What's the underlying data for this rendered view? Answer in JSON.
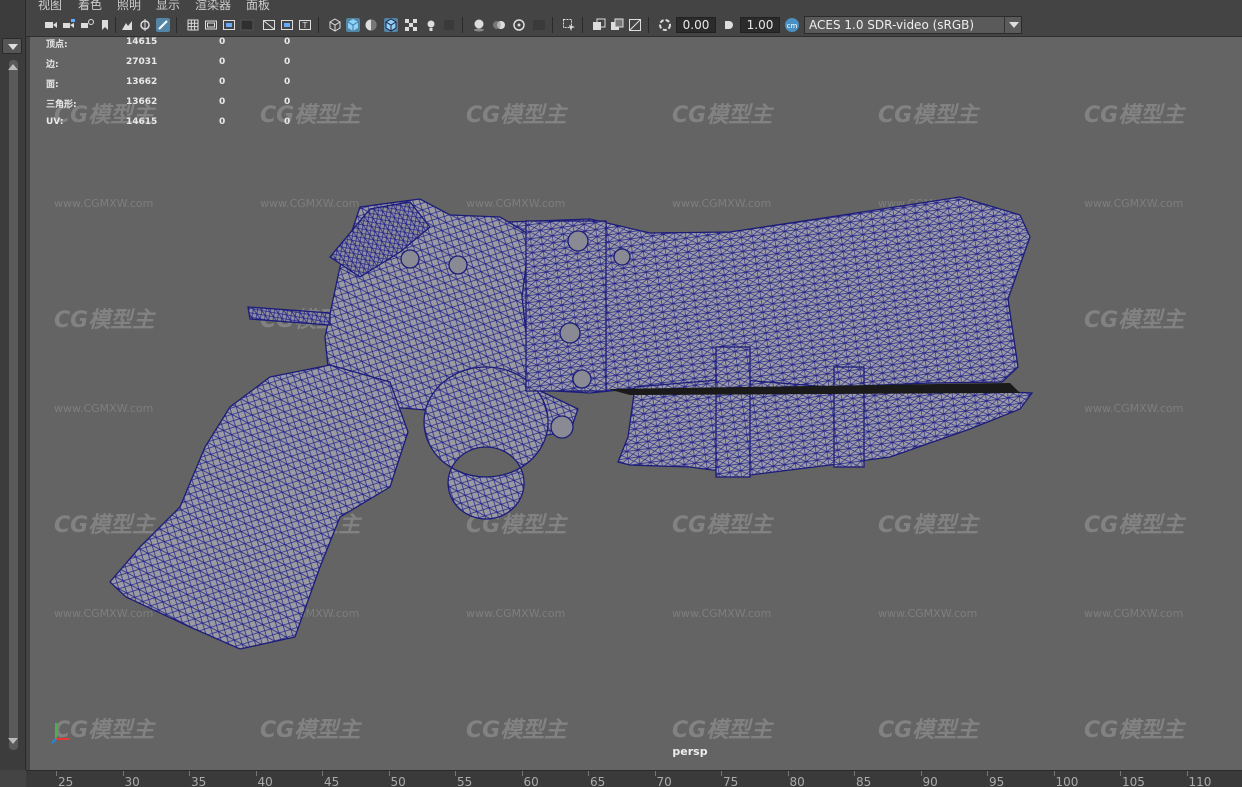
{
  "menu": {
    "items": [
      "视图",
      "着色",
      "照明",
      "显示",
      "渲染器",
      "面板"
    ]
  },
  "toolbar": {
    "exposure_value": "0.00",
    "gamma_value": "1.00",
    "color_space": "ACES 1.0 SDR-video (sRGB)",
    "icons": [
      "select-camera-icon",
      "camera-attributes-icon",
      "bookmark-icon",
      "image-plane-icon",
      "2d-pan-zoom-icon",
      "grease-pencil-icon",
      "grid-icon",
      "film-gate-icon",
      "resolution-gate-icon",
      "gate-mask-icon",
      "field-chart-icon",
      "safe-title-icon",
      "wireframe-icon",
      "smooth-shade-icon",
      "default-material-icon",
      "wireframe-on-shaded-icon",
      "textured-icon",
      "use-all-lights-icon",
      "shadows-icon",
      "screen-space-ao-icon",
      "motion-blur-icon",
      "anti-aliasing-icon",
      "depth-of-field-icon",
      "isolate-select-icon",
      "xray-icon",
      "xray-joints-icon",
      "xray-components-icon",
      "exposure-icon",
      "gamma-icon",
      "color-management-icon"
    ]
  },
  "hud": {
    "rows": [
      {
        "label": "顶点:",
        "total": "14615",
        "selected": "0",
        "uv": "0"
      },
      {
        "label": "边:",
        "total": "27031",
        "selected": "0",
        "uv": "0"
      },
      {
        "label": "面:",
        "total": "13662",
        "selected": "0",
        "uv": "0"
      },
      {
        "label": "三角形:",
        "total": "13662",
        "selected": "0",
        "uv": "0"
      },
      {
        "label": "UV:",
        "total": "14615",
        "selected": "0",
        "uv": "0"
      }
    ]
  },
  "viewport": {
    "camera": "persp",
    "background": "#646464",
    "wireframe_color": "#1f1f8a",
    "mesh_color": "#9a9aa2"
  },
  "watermark": {
    "logo": "CG模型主",
    "url": "www.CGMXW.com"
  },
  "timeslider": {
    "ticks": [
      "25",
      "30",
      "35",
      "40",
      "45",
      "50",
      "55",
      "60",
      "65",
      "70",
      "75",
      "80",
      "85",
      "90",
      "95",
      "100",
      "105",
      "110"
    ]
  }
}
